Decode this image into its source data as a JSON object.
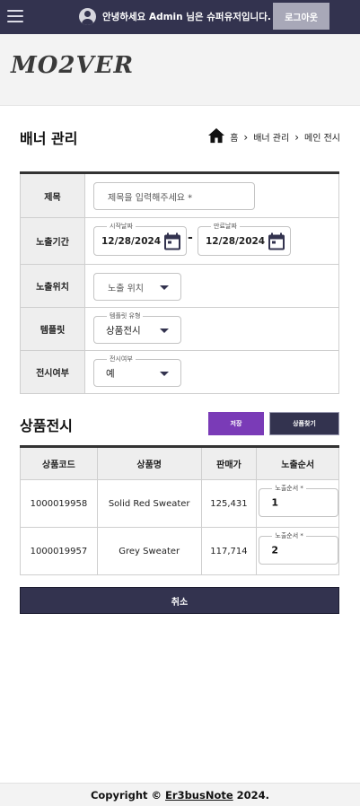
{
  "header": {
    "greeting": "안녕하세요 Admin 님은 슈퍼유저입니다.",
    "logout_label": "로그아웃",
    "icons": {
      "menu": "hamburger-menu-icon",
      "user": "user-avatar-icon"
    }
  },
  "logo": {
    "text": "MO2VER"
  },
  "page": {
    "title": "배너 관리",
    "breadcrumb": {
      "home": "홈",
      "level1": "배너 관리",
      "level2": "메인 전시",
      "separator": "›"
    }
  },
  "form": {
    "title": {
      "label": "제목",
      "placeholder": "제목을 입력해주세요 *"
    },
    "period": {
      "label": "노출기간",
      "start_legend": "시작날짜",
      "start_value": "12/28/2024",
      "separator": "-",
      "end_legend": "만료날짜",
      "end_value": "12/28/2024"
    },
    "position": {
      "label": "노출위치",
      "placeholder": "노출 위치"
    },
    "template": {
      "label": "템플릿",
      "legend": "템플릿 유형",
      "value": "상품전시"
    },
    "display": {
      "label": "전시여부",
      "legend": "전시여부",
      "value": "예"
    }
  },
  "products": {
    "title": "상품전시",
    "save_label": "저장",
    "find_label": "상품찾기",
    "columns": [
      "상품코드",
      "상품명",
      "판매가",
      "노출순서"
    ],
    "order_legend": "노출순서 *",
    "rows": [
      {
        "code": "1000019958",
        "name": "Solid Red Sweater",
        "price": "125,431",
        "order": "1"
      },
      {
        "code": "1000019957",
        "name": "Grey Sweater",
        "price": "117,714",
        "order": "2"
      }
    ]
  },
  "cancel_label": "취소",
  "footer": {
    "prefix": "Copyright ©",
    "author": "Er3busNote",
    "year": "2024."
  },
  "colors": {
    "primary": "#33334f",
    "accent": "#7a3bb7",
    "logout_bg": "#a8a8b8",
    "label_bg": "#eeeeee"
  }
}
